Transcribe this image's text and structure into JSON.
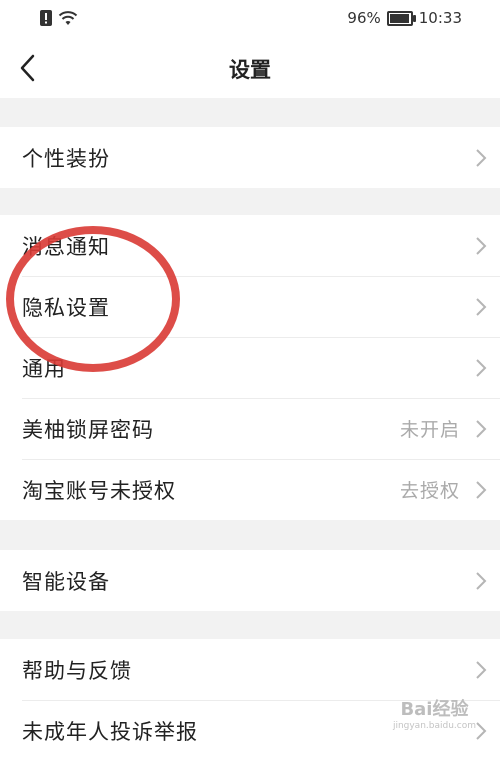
{
  "status_bar": {
    "battery_percent": "96%",
    "battery_level": 0.96,
    "time": "10:33",
    "icons": [
      "alert-sim-icon",
      "wifi-icon",
      "battery-icon"
    ]
  },
  "header": {
    "title": "设置",
    "back_icon": "chevron-left-icon"
  },
  "groups": [
    {
      "items": [
        {
          "label": "个性装扮"
        }
      ]
    },
    {
      "items": [
        {
          "label": "消息通知"
        },
        {
          "label": "隐私设置"
        },
        {
          "label": "通用"
        },
        {
          "label": "美柚锁屏密码",
          "value": "未开启"
        },
        {
          "label": "淘宝账号未授权",
          "value": "去授权"
        }
      ]
    },
    {
      "items": [
        {
          "label": "智能设备"
        }
      ]
    },
    {
      "items": [
        {
          "label": "帮助与反馈"
        },
        {
          "label": "未成年人投诉举报"
        }
      ]
    }
  ],
  "annotation_color": "#d93a34",
  "watermark": {
    "text": "Bai经验",
    "sub": "jingyan.baidu.com"
  }
}
